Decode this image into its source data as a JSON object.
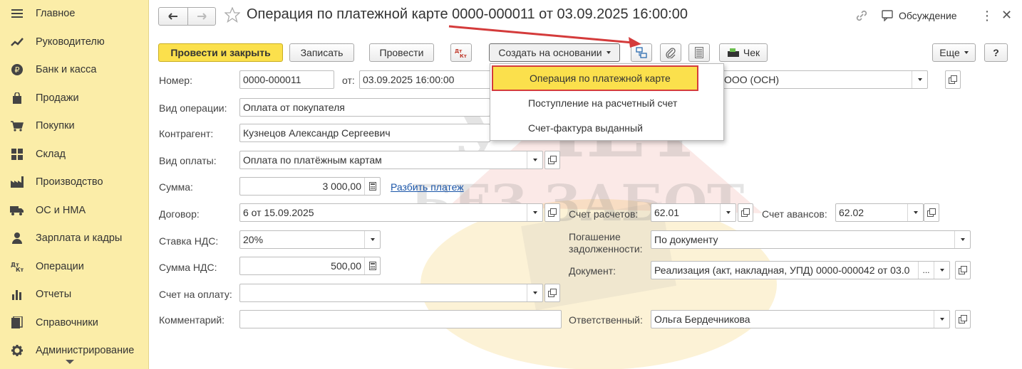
{
  "sidebar": {
    "items": [
      {
        "label": "Главное",
        "icon": "menu-lines-icon"
      },
      {
        "label": "Руководителю",
        "icon": "trend-chart-icon"
      },
      {
        "label": "Банк и касса",
        "icon": "ruble-coin-icon"
      },
      {
        "label": "Продажи",
        "icon": "shopping-bag-icon"
      },
      {
        "label": "Покупки",
        "icon": "shopping-cart-icon"
      },
      {
        "label": "Склад",
        "icon": "warehouse-grid-icon"
      },
      {
        "label": "Производство",
        "icon": "factory-icon"
      },
      {
        "label": "ОС и НМА",
        "icon": "truck-icon"
      },
      {
        "label": "Зарплата и кадры",
        "icon": "person-icon"
      },
      {
        "label": "Операции",
        "icon": "dt-kt-icon"
      },
      {
        "label": "Отчеты",
        "icon": "bar-chart-icon"
      },
      {
        "label": "Справочники",
        "icon": "books-icon"
      },
      {
        "label": "Администрирование",
        "icon": "gear-icon"
      }
    ]
  },
  "header": {
    "title": "Операция по платежной карте 0000-000011 от 03.09.2025 16:00:00",
    "discussion": "Обсуждение"
  },
  "toolbar": {
    "post_close": "Провести и закрыть",
    "save": "Записать",
    "post": "Провести",
    "create_based": "Создать на основании",
    "check": "Чек",
    "more": "Еще",
    "help": "?"
  },
  "dropdown": {
    "items": [
      "Операция по платежной карте",
      "Поступление на расчетный счет",
      "Счет-фактура выданный"
    ]
  },
  "form": {
    "number_label": "Номер:",
    "number_value": "0000-000011",
    "date_label": "от:",
    "date_value": "03.09.2025 16:00:00",
    "org_value": "ООО (ОСН)",
    "op_type_label": "Вид операции:",
    "op_type_value": "Оплата от покупателя",
    "counterparty_label": "Контрагент:",
    "counterparty_value": "Кузнецов Александр Сергеевич",
    "pay_type_label": "Вид оплаты:",
    "pay_type_value": "Оплата по платёжным картам",
    "sum_label": "Сумма:",
    "sum_value": "3 000,00",
    "split_link": "Разбить платеж",
    "contract_label": "Договор:",
    "contract_value": "6 от 15.09.2025",
    "vat_rate_label": "Ставка НДС:",
    "vat_rate_value": "20%",
    "vat_sum_label": "Сумма НДС:",
    "vat_sum_value": "500,00",
    "invoice_label": "Счет на оплату:",
    "invoice_value": "",
    "comment_label": "Комментарий:",
    "comment_value": "",
    "settle_acc_label": "Счет расчетов:",
    "settle_acc_value": "62.01",
    "adv_acc_label": "Счет авансов:",
    "adv_acc_value": "62.02",
    "repay_label_1": "Погашение",
    "repay_label_2": "задолженности:",
    "repay_value": "По документу",
    "doc_label": "Документ:",
    "doc_value": "Реализация (акт, накладная, УПД) 0000-000042 от 03.0",
    "resp_label": "Ответственный:",
    "resp_value": "Ольга Бердечникова"
  },
  "colors": {
    "sidebar_bg": "#fbeda8",
    "primary_button": "#fbe04c",
    "highlight_border": "#d43b3b",
    "link": "#1a55a8"
  }
}
